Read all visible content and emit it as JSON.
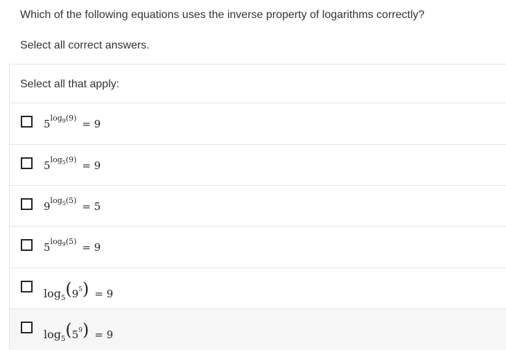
{
  "question": {
    "text": "Which of the following equations uses the inverse property of logarithms correctly?",
    "instruction": "Select all correct answers."
  },
  "answer_area": {
    "label": "Select all that apply:",
    "options": [
      {
        "type": "exp",
        "base": "5",
        "log": "log",
        "log_base": "9",
        "arg": "(9)",
        "eq": "= 9"
      },
      {
        "type": "exp",
        "base": "5",
        "log": "log",
        "log_base": "5",
        "arg": "(9)",
        "eq": "= 9"
      },
      {
        "type": "exp",
        "base": "9",
        "log": "log",
        "log_base": "5",
        "arg": "(5)",
        "eq": "= 5"
      },
      {
        "type": "exp",
        "base": "5",
        "log": "log",
        "log_base": "9",
        "arg": "(5)",
        "eq": "= 9"
      },
      {
        "type": "log",
        "log": "log",
        "log_base": "5",
        "inner_base": "9",
        "inner_exp": "5",
        "eq": "= 9"
      },
      {
        "type": "log",
        "log": "log",
        "log_base": "5",
        "inner_base": "5",
        "inner_exp": "9",
        "eq": "= 9"
      }
    ]
  }
}
